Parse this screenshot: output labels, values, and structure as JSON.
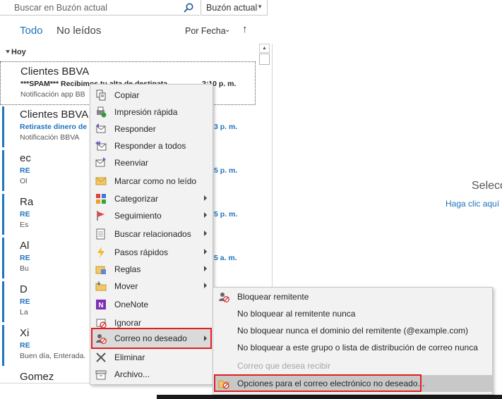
{
  "search": {
    "placeholder": "Buscar en Buzón actual",
    "scope": "Buzón actual"
  },
  "filters": {
    "all": "Todo",
    "unread": "No leídos",
    "sort": "Por Fecha"
  },
  "group_label": "Hoy",
  "mails": [
    {
      "sender": "Clientes BBVA",
      "subject": "***SPAM***  Recibimos tu alta de destinata",
      "time": "2:10 p. m.",
      "preview": "Notificación app BB"
    },
    {
      "sender": "Clientes BBVA",
      "subject": "Retiraste dinero de",
      "time": "3 p. m.",
      "preview": "Notificación BBVA"
    },
    {
      "sender": "ec",
      "subject": "RE",
      "time": "5 p. m.",
      "preview": "Ol"
    },
    {
      "sender": "Ra",
      "subject": "RE",
      "time": "5 p. m.",
      "preview": "Es"
    },
    {
      "sender": "Al",
      "subject": "RE",
      "time": "5 a. m.",
      "preview": "Bu"
    },
    {
      "sender": "D",
      "subject": "RE",
      "time": "",
      "preview": "La"
    },
    {
      "sender": "Xi",
      "subject": "RE",
      "time": "",
      "preview": "Buen día, Enterada."
    },
    {
      "sender": "Gomez",
      "subject": "",
      "time": "",
      "preview": ""
    }
  ],
  "reading": {
    "title": "Seleco",
    "link": "Haga clic aquí p"
  },
  "context_menu": [
    {
      "label": "Copiar",
      "icon": "copy-icon",
      "submenu": false
    },
    {
      "label": "Impresión rápida",
      "icon": "quick-print-icon",
      "submenu": false
    },
    {
      "label": "Responder",
      "icon": "reply-icon",
      "submenu": false
    },
    {
      "label": "Responder a todos",
      "icon": "reply-all-icon",
      "submenu": false
    },
    {
      "label": "Reenviar",
      "icon": "forward-icon",
      "submenu": false
    },
    {
      "label": "Marcar como no leído",
      "icon": "mark-unread-icon",
      "submenu": false
    },
    {
      "label": "Categorizar",
      "icon": "categorize-icon",
      "submenu": true
    },
    {
      "label": "Seguimiento",
      "icon": "flag-icon",
      "submenu": true
    },
    {
      "label": "Buscar relacionados",
      "icon": "find-related-icon",
      "submenu": true
    },
    {
      "label": "Pasos rápidos",
      "icon": "quick-steps-icon",
      "submenu": true
    },
    {
      "label": "Reglas",
      "icon": "rules-icon",
      "submenu": true
    },
    {
      "label": "Mover",
      "icon": "move-icon",
      "submenu": true
    },
    {
      "label": "OneNote",
      "icon": "onenote-icon",
      "submenu": false
    },
    {
      "label": "Ignorar",
      "icon": "ignore-icon",
      "submenu": false
    },
    {
      "label": "Correo no deseado",
      "icon": "junk-mail-icon",
      "submenu": true
    },
    {
      "label": "Eliminar",
      "icon": "delete-icon",
      "submenu": false
    },
    {
      "label": "Archivo...",
      "icon": "archive-icon",
      "submenu": false
    }
  ],
  "junk_submenu": [
    {
      "label": "Bloquear remitente",
      "icon": "block-sender-icon",
      "disabled": false
    },
    {
      "label": "No bloquear al remitente nunca",
      "icon": "",
      "disabled": false
    },
    {
      "label": "No bloquear nunca el dominio del remitente (@example.com)",
      "icon": "",
      "disabled": false
    },
    {
      "label": "No bloquear a este grupo o lista de distribución de correo nunca",
      "icon": "",
      "disabled": false
    },
    {
      "label": "Correo que desea recibir",
      "icon": "",
      "disabled": true
    },
    {
      "label": "Opciones para el correo electrónico no deseado...",
      "icon": "junk-options-icon",
      "disabled": false
    }
  ],
  "colors": {
    "accent": "#1e73be",
    "highlight_box": "#e02020"
  }
}
